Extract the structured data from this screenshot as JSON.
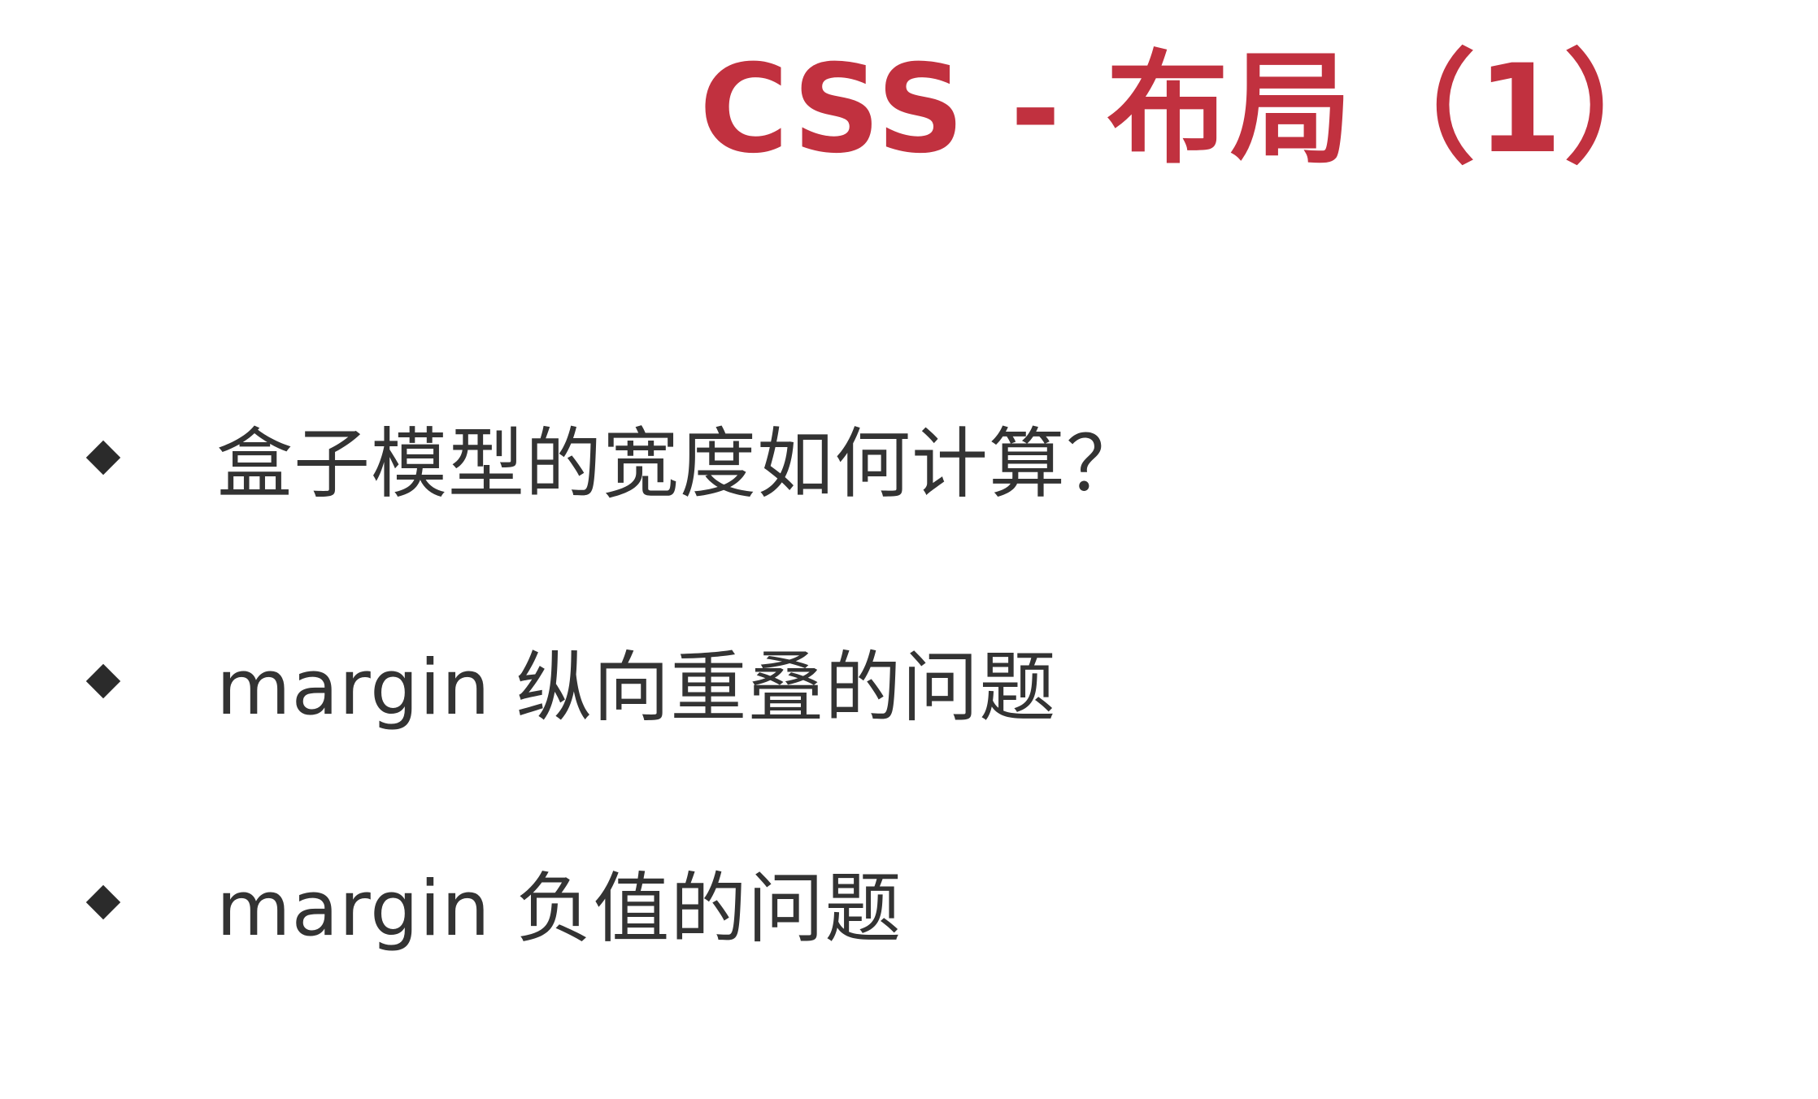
{
  "slide": {
    "title": "CSS - 布局（1）",
    "bullets": [
      {
        "text": "盒子模型的宽度如何计算？",
        "icon": "diamond-bullet-icon"
      },
      {
        "text": "margin 纵向重叠的问题",
        "icon": "diamond-bullet-icon"
      },
      {
        "text": "margin 负值的问题",
        "icon": "diamond-bullet-icon"
      }
    ]
  },
  "colors": {
    "title": "#c1313f",
    "text": "#333333",
    "bullet": "#2b2b2b",
    "background": "#ffffff"
  }
}
